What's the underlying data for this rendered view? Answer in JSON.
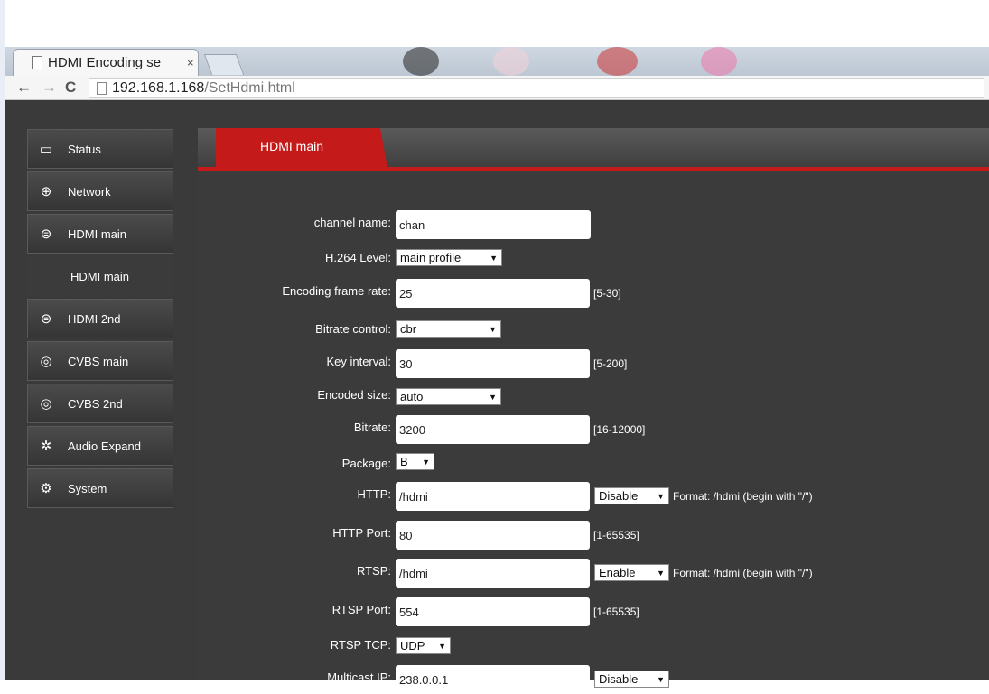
{
  "browser": {
    "tab_title": "HDMI Encoding se",
    "tab_close": "×",
    "url_host": "192.168.1.168",
    "url_path": "/SetHdmi.html"
  },
  "sidebar": {
    "items": [
      {
        "label": "Status",
        "icon": "monitor-icon",
        "glyph": "▭"
      },
      {
        "label": "Network",
        "icon": "globe-icon",
        "glyph": "⊕"
      },
      {
        "label": "HDMI main",
        "icon": "hdmi-icon",
        "glyph": "⊜"
      },
      {
        "label": "HDMI main",
        "sub": true
      },
      {
        "label": "HDMI 2nd",
        "icon": "hdmi-icon",
        "glyph": "⊜"
      },
      {
        "label": "CVBS main",
        "icon": "cvbs-icon",
        "glyph": "◎"
      },
      {
        "label": "CVBS 2nd",
        "icon": "cvbs-icon",
        "glyph": "◎"
      },
      {
        "label": "Audio Expand",
        "icon": "audio-icon",
        "glyph": "✲"
      },
      {
        "label": "System",
        "icon": "gear-icon",
        "glyph": "⚙"
      }
    ]
  },
  "main": {
    "tab_label": "HDMI main",
    "fields": {
      "channel_name": {
        "label": "channel name:",
        "value": "chan"
      },
      "h264_level": {
        "label": "H.264 Level:",
        "value": "main profile"
      },
      "frame_rate": {
        "label": "Encoding frame rate:",
        "value": "25",
        "range": "[5-30]"
      },
      "bitrate_control": {
        "label": "Bitrate control:",
        "value": "cbr"
      },
      "key_interval": {
        "label": "Key interval:",
        "value": "30",
        "range": "[5-200]"
      },
      "encoded_size": {
        "label": "Encoded size:",
        "value": "auto"
      },
      "bitrate": {
        "label": "Bitrate:",
        "value": "3200",
        "range": "[16-12000]"
      },
      "package": {
        "label": "Package:",
        "value": "B"
      },
      "http": {
        "label": "HTTP:",
        "value": "/hdmi",
        "mode": "Disable",
        "format": "Format: /hdmi (begin with \"/\")"
      },
      "http_port": {
        "label": "HTTP Port:",
        "value": "80",
        "range": "[1-65535]"
      },
      "rtsp": {
        "label": "RTSP:",
        "value": "/hdmi",
        "mode": "Enable",
        "format": "Format: /hdmi (begin with \"/\")"
      },
      "rtsp_port": {
        "label": "RTSP Port:",
        "value": "554",
        "range": "[1-65535]"
      },
      "rtsp_tcp": {
        "label": "RTSP TCP:",
        "value": "UDP"
      },
      "multicast_ip": {
        "label": "Multicast IP:",
        "value": "238.0.0.1",
        "mode": "Disable"
      }
    }
  }
}
